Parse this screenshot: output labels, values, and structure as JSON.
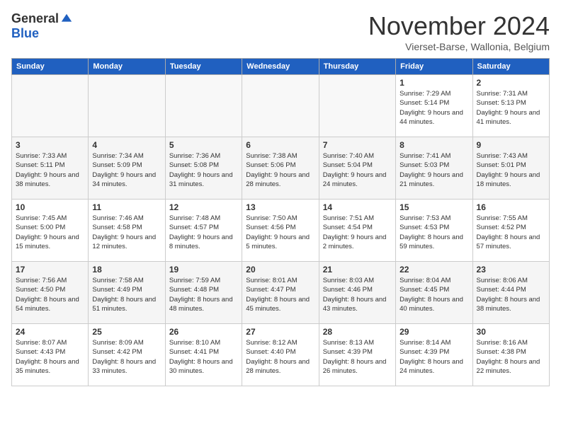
{
  "header": {
    "logo_general": "General",
    "logo_blue": "Blue",
    "month_title": "November 2024",
    "location": "Vierset-Barse, Wallonia, Belgium"
  },
  "days_of_week": [
    "Sunday",
    "Monday",
    "Tuesday",
    "Wednesday",
    "Thursday",
    "Friday",
    "Saturday"
  ],
  "weeks": [
    {
      "days": [
        {
          "num": "",
          "info": ""
        },
        {
          "num": "",
          "info": ""
        },
        {
          "num": "",
          "info": ""
        },
        {
          "num": "",
          "info": ""
        },
        {
          "num": "",
          "info": ""
        },
        {
          "num": "1",
          "info": "Sunrise: 7:29 AM\nSunset: 5:14 PM\nDaylight: 9 hours and 44 minutes."
        },
        {
          "num": "2",
          "info": "Sunrise: 7:31 AM\nSunset: 5:13 PM\nDaylight: 9 hours and 41 minutes."
        }
      ]
    },
    {
      "days": [
        {
          "num": "3",
          "info": "Sunrise: 7:33 AM\nSunset: 5:11 PM\nDaylight: 9 hours and 38 minutes."
        },
        {
          "num": "4",
          "info": "Sunrise: 7:34 AM\nSunset: 5:09 PM\nDaylight: 9 hours and 34 minutes."
        },
        {
          "num": "5",
          "info": "Sunrise: 7:36 AM\nSunset: 5:08 PM\nDaylight: 9 hours and 31 minutes."
        },
        {
          "num": "6",
          "info": "Sunrise: 7:38 AM\nSunset: 5:06 PM\nDaylight: 9 hours and 28 minutes."
        },
        {
          "num": "7",
          "info": "Sunrise: 7:40 AM\nSunset: 5:04 PM\nDaylight: 9 hours and 24 minutes."
        },
        {
          "num": "8",
          "info": "Sunrise: 7:41 AM\nSunset: 5:03 PM\nDaylight: 9 hours and 21 minutes."
        },
        {
          "num": "9",
          "info": "Sunrise: 7:43 AM\nSunset: 5:01 PM\nDaylight: 9 hours and 18 minutes."
        }
      ]
    },
    {
      "days": [
        {
          "num": "10",
          "info": "Sunrise: 7:45 AM\nSunset: 5:00 PM\nDaylight: 9 hours and 15 minutes."
        },
        {
          "num": "11",
          "info": "Sunrise: 7:46 AM\nSunset: 4:58 PM\nDaylight: 9 hours and 12 minutes."
        },
        {
          "num": "12",
          "info": "Sunrise: 7:48 AM\nSunset: 4:57 PM\nDaylight: 9 hours and 8 minutes."
        },
        {
          "num": "13",
          "info": "Sunrise: 7:50 AM\nSunset: 4:56 PM\nDaylight: 9 hours and 5 minutes."
        },
        {
          "num": "14",
          "info": "Sunrise: 7:51 AM\nSunset: 4:54 PM\nDaylight: 9 hours and 2 minutes."
        },
        {
          "num": "15",
          "info": "Sunrise: 7:53 AM\nSunset: 4:53 PM\nDaylight: 8 hours and 59 minutes."
        },
        {
          "num": "16",
          "info": "Sunrise: 7:55 AM\nSunset: 4:52 PM\nDaylight: 8 hours and 57 minutes."
        }
      ]
    },
    {
      "days": [
        {
          "num": "17",
          "info": "Sunrise: 7:56 AM\nSunset: 4:50 PM\nDaylight: 8 hours and 54 minutes."
        },
        {
          "num": "18",
          "info": "Sunrise: 7:58 AM\nSunset: 4:49 PM\nDaylight: 8 hours and 51 minutes."
        },
        {
          "num": "19",
          "info": "Sunrise: 7:59 AM\nSunset: 4:48 PM\nDaylight: 8 hours and 48 minutes."
        },
        {
          "num": "20",
          "info": "Sunrise: 8:01 AM\nSunset: 4:47 PM\nDaylight: 8 hours and 45 minutes."
        },
        {
          "num": "21",
          "info": "Sunrise: 8:03 AM\nSunset: 4:46 PM\nDaylight: 8 hours and 43 minutes."
        },
        {
          "num": "22",
          "info": "Sunrise: 8:04 AM\nSunset: 4:45 PM\nDaylight: 8 hours and 40 minutes."
        },
        {
          "num": "23",
          "info": "Sunrise: 8:06 AM\nSunset: 4:44 PM\nDaylight: 8 hours and 38 minutes."
        }
      ]
    },
    {
      "days": [
        {
          "num": "24",
          "info": "Sunrise: 8:07 AM\nSunset: 4:43 PM\nDaylight: 8 hours and 35 minutes."
        },
        {
          "num": "25",
          "info": "Sunrise: 8:09 AM\nSunset: 4:42 PM\nDaylight: 8 hours and 33 minutes."
        },
        {
          "num": "26",
          "info": "Sunrise: 8:10 AM\nSunset: 4:41 PM\nDaylight: 8 hours and 30 minutes."
        },
        {
          "num": "27",
          "info": "Sunrise: 8:12 AM\nSunset: 4:40 PM\nDaylight: 8 hours and 28 minutes."
        },
        {
          "num": "28",
          "info": "Sunrise: 8:13 AM\nSunset: 4:39 PM\nDaylight: 8 hours and 26 minutes."
        },
        {
          "num": "29",
          "info": "Sunrise: 8:14 AM\nSunset: 4:39 PM\nDaylight: 8 hours and 24 minutes."
        },
        {
          "num": "30",
          "info": "Sunrise: 8:16 AM\nSunset: 4:38 PM\nDaylight: 8 hours and 22 minutes."
        }
      ]
    }
  ]
}
